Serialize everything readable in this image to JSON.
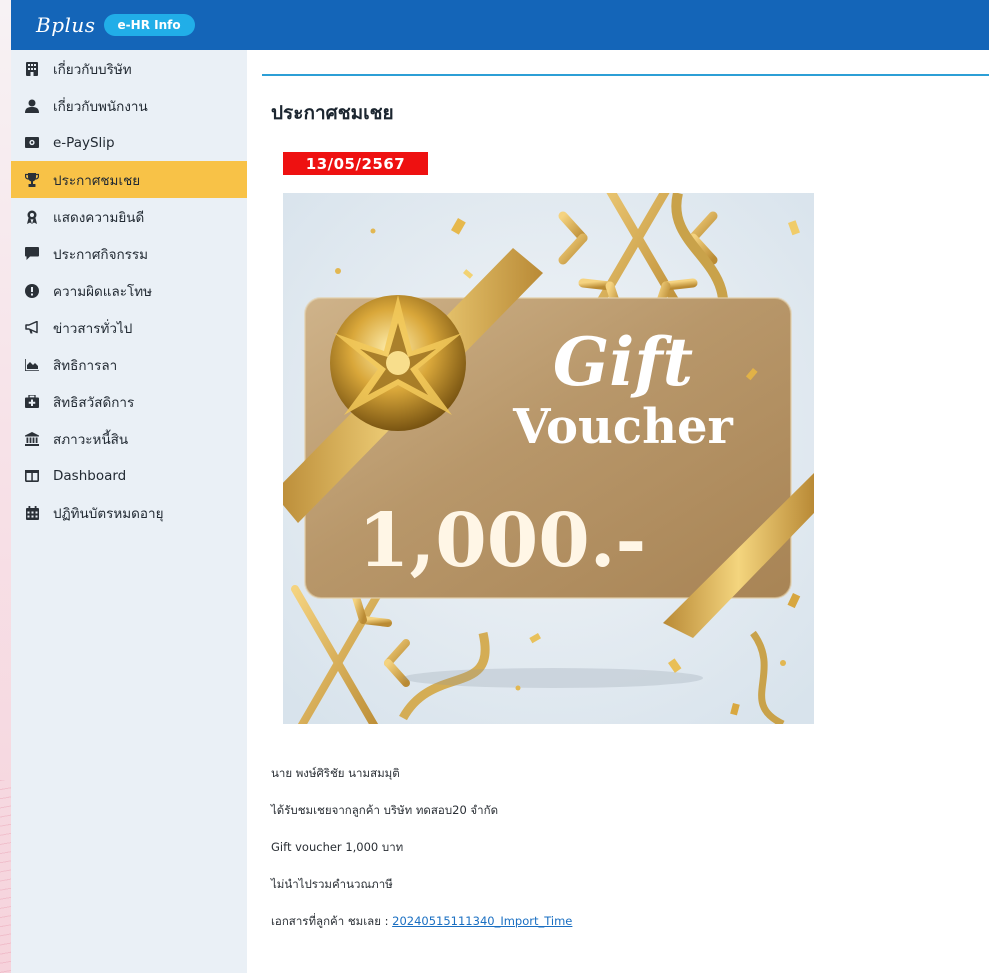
{
  "header": {
    "brand": "Bplus",
    "badge": "e-HR Info",
    "bg_color": "#1465b8"
  },
  "sidebar": {
    "items": [
      {
        "label": "เกี่ยวกับบริษัท",
        "icon": "building-icon"
      },
      {
        "label": "เกี่ยวกับพนักงาน",
        "icon": "user-icon"
      },
      {
        "label": "e-PaySlip",
        "icon": "money-icon"
      },
      {
        "label": "ประกาศชมเชย",
        "icon": "trophy-icon",
        "active": true
      },
      {
        "label": "แสดงความยินดี",
        "icon": "award-icon"
      },
      {
        "label": "ประกาศกิจกรรม",
        "icon": "comment-icon"
      },
      {
        "label": "ความผิดและโทษ",
        "icon": "exclamation-icon"
      },
      {
        "label": "ข่าวสารทั่วไป",
        "icon": "bullhorn-icon"
      },
      {
        "label": "สิทธิการลา",
        "icon": "chart-area-icon"
      },
      {
        "label": "สิทธิสวัสดิการ",
        "icon": "medkit-icon"
      },
      {
        "label": "สภาวะหนี้สิน",
        "icon": "bank-icon"
      },
      {
        "label": "Dashboard",
        "icon": "columns-icon"
      },
      {
        "label": "ปฏิทินบัตรหมดอายุ",
        "icon": "calendar-icon"
      }
    ],
    "active_color": "#f8c247"
  },
  "main": {
    "title": "ประกาศชมเชย",
    "date": "13/05/2567",
    "voucher": {
      "word1": "Gift",
      "word2": "Voucher",
      "amount": "1,000.-"
    },
    "details": {
      "name": "นาย พงษ์ศิริชัย นามสมมุติ",
      "received": "ได้รับชมเชยจากลูกค้า บริษัท ทดสอบ20 จำกัด",
      "reward": "Gift voucher 1,000 บาท",
      "tax": "ไม่นำไปรวมคำนวณภาษี",
      "doc_label": "เอกสารที่ลูกค้า ชมเลย : ",
      "doc_link": "20240515111340_Import_Time"
    }
  }
}
